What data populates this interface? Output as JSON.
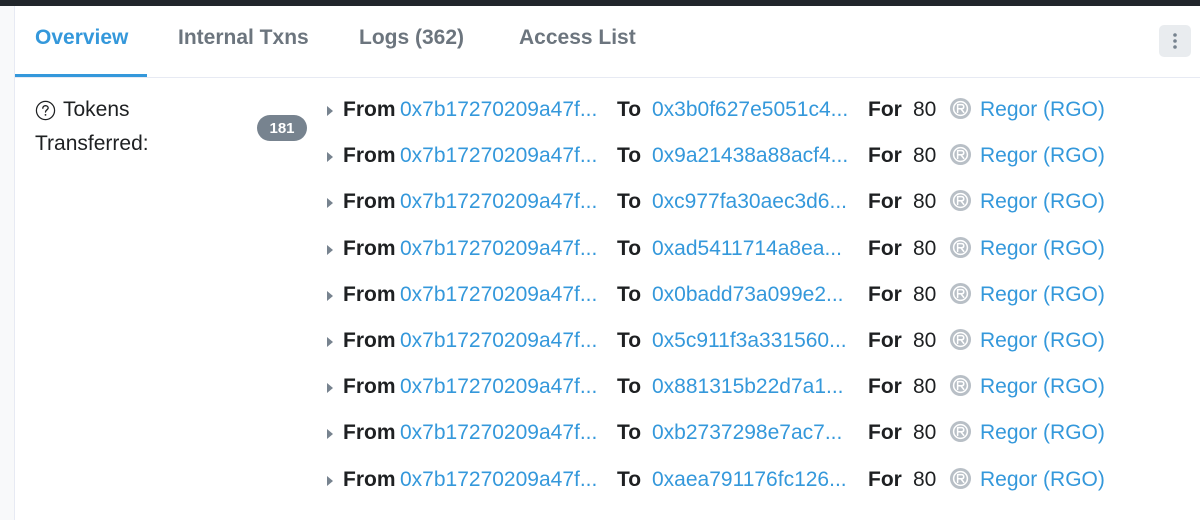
{
  "tabs": [
    {
      "label": "Overview",
      "active": true
    },
    {
      "label": "Internal Txns",
      "active": false
    },
    {
      "label": "Logs (362)",
      "active": false
    },
    {
      "label": "Access List",
      "active": false
    }
  ],
  "tokens": {
    "label_line1": "Tokens",
    "label_line2": "Transferred:",
    "count": "181",
    "from_label": "From",
    "to_label": "To",
    "for_label": "For",
    "token_icon": "regor-token-icon",
    "rows": [
      {
        "from": "0x7b17270209a47f...",
        "to": "0x3b0f627e5051c4...",
        "amount": "80",
        "token": "Regor (RGO)"
      },
      {
        "from": "0x7b17270209a47f...",
        "to": "0x9a21438a88acf4...",
        "amount": "80",
        "token": "Regor (RGO)"
      },
      {
        "from": "0x7b17270209a47f...",
        "to": "0xc977fa30aec3d6...",
        "amount": "80",
        "token": "Regor (RGO)"
      },
      {
        "from": "0x7b17270209a47f...",
        "to": "0xad5411714a8ea...",
        "amount": "80",
        "token": "Regor (RGO)"
      },
      {
        "from": "0x7b17270209a47f...",
        "to": "0x0badd73a099e2...",
        "amount": "80",
        "token": "Regor (RGO)"
      },
      {
        "from": "0x7b17270209a47f...",
        "to": "0x5c911f3a331560...",
        "amount": "80",
        "token": "Regor (RGO)"
      },
      {
        "from": "0x7b17270209a47f...",
        "to": "0x881315b22d7a1...",
        "amount": "80",
        "token": "Regor (RGO)"
      },
      {
        "from": "0x7b17270209a47f...",
        "to": "0xb2737298e7ac7...",
        "amount": "80",
        "token": "Regor (RGO)"
      },
      {
        "from": "0x7b17270209a47f...",
        "to": "0xaea791176fc126...",
        "amount": "80",
        "token": "Regor (RGO)"
      }
    ]
  },
  "colors": {
    "accent": "#3498db",
    "text": "#1e2022",
    "muted": "#77838f",
    "topbar": "#21262b"
  }
}
